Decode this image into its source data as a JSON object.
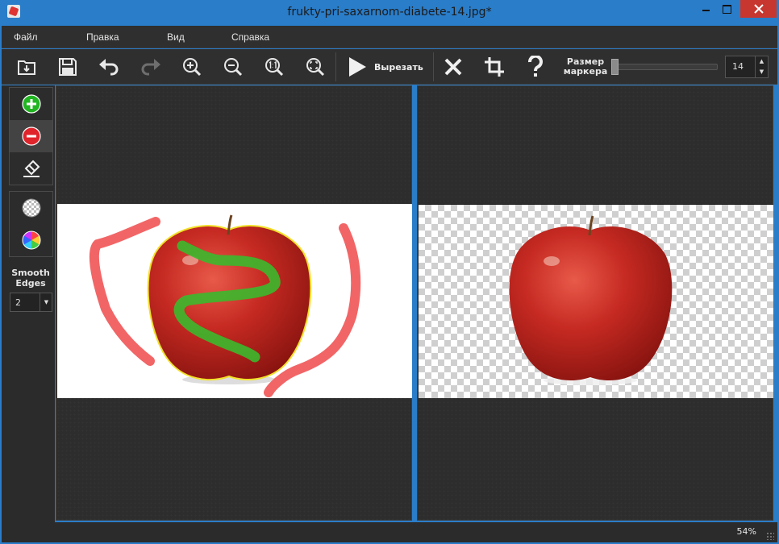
{
  "window": {
    "title": "frukty-pri-saxarnom-diabete-14.jpg*",
    "accent_color": "#2a7dc9",
    "close_color": "#c7372f"
  },
  "menu": {
    "items": [
      {
        "label": "Файл"
      },
      {
        "label": "Правка"
      },
      {
        "label": "Вид"
      },
      {
        "label": "Справка"
      }
    ]
  },
  "toolbar": {
    "icons": [
      "open-icon",
      "save-icon",
      "undo-icon",
      "redo-icon",
      "zoom-in-icon",
      "zoom-out-icon",
      "zoom-actual-icon",
      "zoom-fit-icon"
    ],
    "cut_label": "Вырезать",
    "cancel_icon": "close-x-icon",
    "crop_icon": "crop-icon",
    "help_icon": "help-icon",
    "marker_size_label": "Размер маркера",
    "marker_size_value": "14"
  },
  "tools": {
    "keep_icon": "plus-circle-icon",
    "remove_icon": "minus-circle-icon",
    "eraser_icon": "eraser-icon",
    "background_icon": "transparency-icon",
    "color_icon": "color-wheel-icon",
    "keep_color": "#21b521",
    "remove_color": "#e0242b",
    "smooth_edges_label": "Smooth Edges",
    "smooth_edges_value": "2"
  },
  "status": {
    "zoom": "54%"
  }
}
